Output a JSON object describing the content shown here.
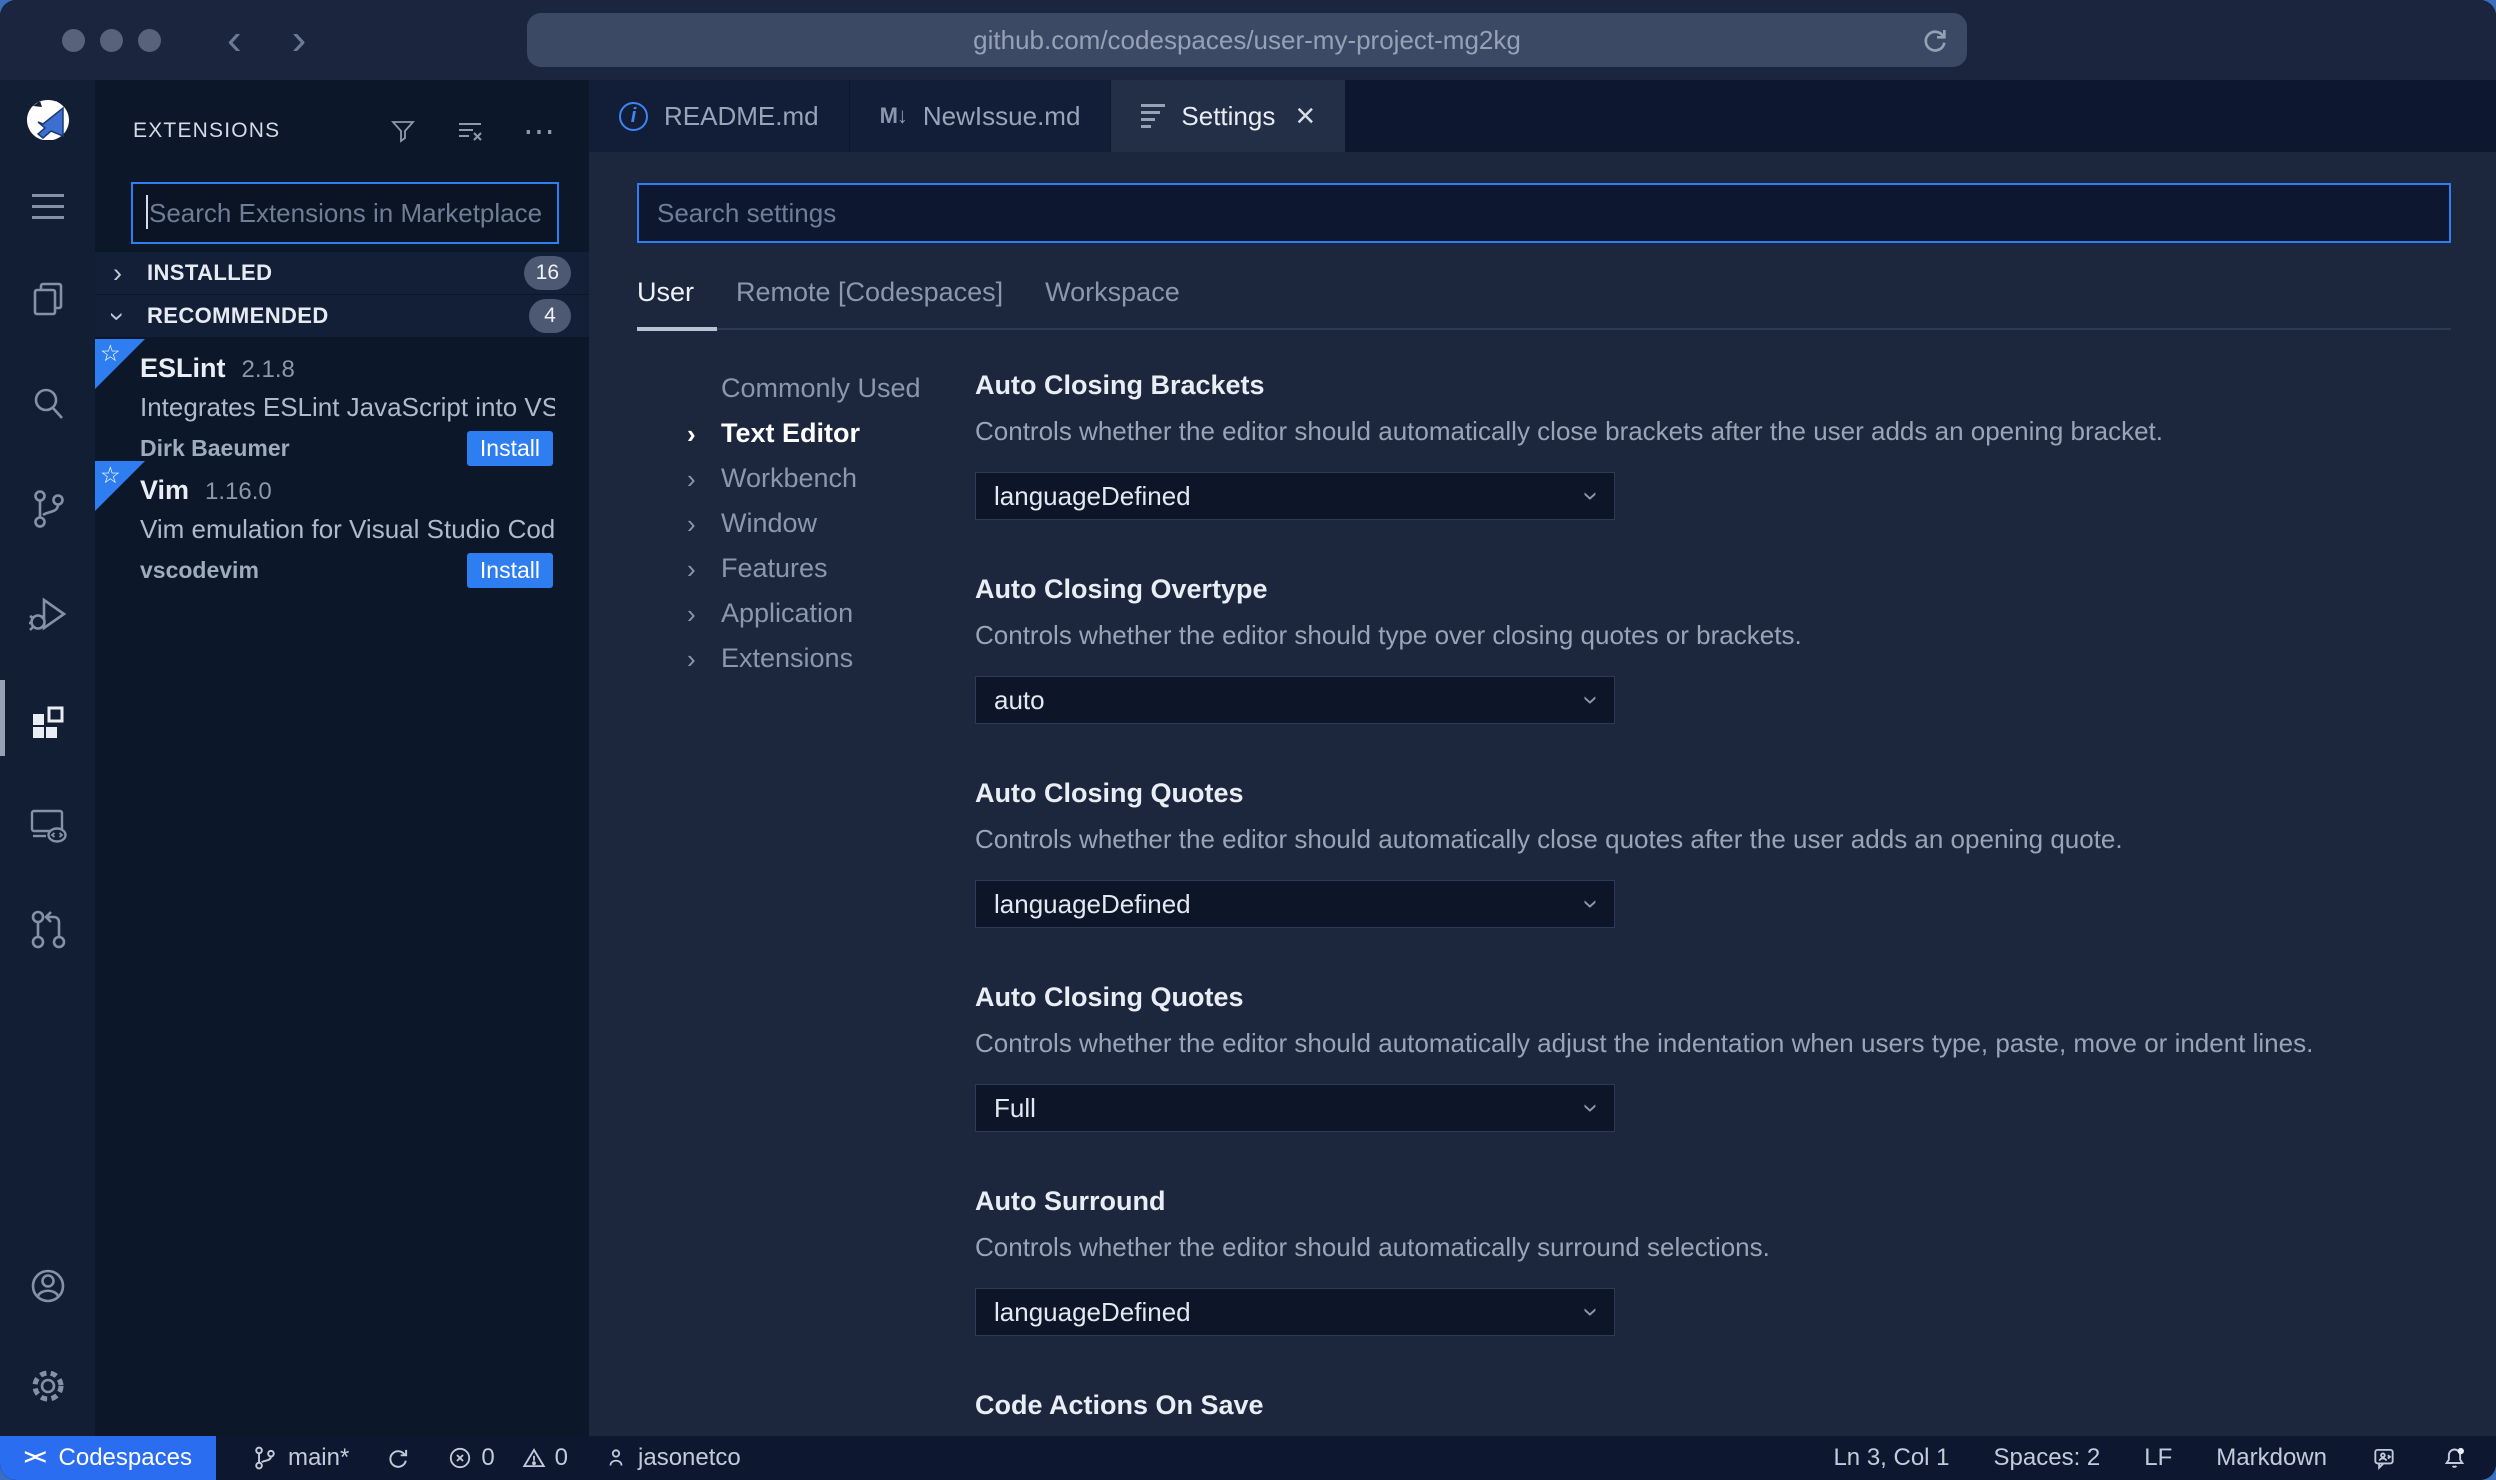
{
  "browser": {
    "url": "github.com/codespaces/user-my-project-mg2kg"
  },
  "glyphs": {
    "back": "‹",
    "forward": "›",
    "more": "⋯",
    "close": "×",
    "chevron": "›",
    "info": "i",
    "markdown": "M↓",
    "star": "☆",
    "remote": "><"
  },
  "sidebar": {
    "title": "EXTENSIONS",
    "search_placeholder": "Search Extensions in Marketplace",
    "sections": [
      {
        "label": "INSTALLED",
        "count": "16"
      },
      {
        "label": "RECOMMENDED",
        "count": "4"
      }
    ],
    "extensions": [
      {
        "name": "ESLint",
        "version": "2.1.8",
        "description": "Integrates ESLint JavaScript into VS C...",
        "publisher": "Dirk Baeumer",
        "action": "Install"
      },
      {
        "name": "Vim",
        "version": "1.16.0",
        "description": "Vim emulation for Visual Studio Code...",
        "publisher": "vscodevim",
        "action": "Install"
      }
    ]
  },
  "tabs": [
    {
      "label": "README.md"
    },
    {
      "label": "NewIssue.md"
    },
    {
      "label": "Settings"
    }
  ],
  "settings": {
    "search_placeholder": "Search settings",
    "scopes": [
      "User",
      "Remote [Codespaces]",
      "Workspace"
    ],
    "tree": [
      "Commonly Used",
      "Text Editor",
      "Workbench",
      "Window",
      "Features",
      "Application",
      "Extensions"
    ],
    "items": [
      {
        "title": "Auto Closing Brackets",
        "description": "Controls whether the editor should automatically close brackets after the user adds an opening bracket.",
        "value": "languageDefined"
      },
      {
        "title": "Auto Closing Overtype",
        "description": "Controls whether the editor should type over closing quotes or brackets.",
        "value": "auto"
      },
      {
        "title": "Auto Closing Quotes",
        "description": "Controls whether the editor should automatically close quotes after the user adds an opening quote.",
        "value": "languageDefined"
      },
      {
        "title": "Auto Closing Quotes",
        "description": "Controls whether the editor should automatically adjust the indentation when users type, paste, move or indent lines.",
        "value": "Full"
      },
      {
        "title": "Auto Surround",
        "description": "Controls whether the editor should automatically surround selections.",
        "value": "languageDefined"
      },
      {
        "title": "Code Actions On Save"
      }
    ]
  },
  "status_bar": {
    "codespaces": "Codespaces",
    "branch": "main*",
    "errors": "0",
    "warnings": "0",
    "user": "jasonetco",
    "line_col": "Ln 3, Col 1",
    "spaces": "Spaces: 2",
    "eol": "LF",
    "language": "Markdown"
  },
  "colors": {
    "accent_blue": "#2e7ef2",
    "focus_border": "#2d7ff2",
    "codespaces_blue": "#2a6df0",
    "badge_bg": "#4d5872",
    "info_blue": "#3d85f2",
    "editor_bg": "#1c273e",
    "sidebar_bg": "#0c1729",
    "chrome_bg": "#1b263e"
  }
}
